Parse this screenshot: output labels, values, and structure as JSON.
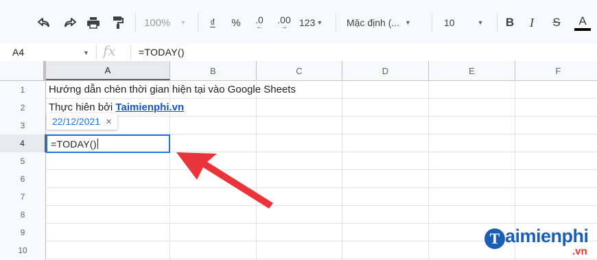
{
  "toolbar": {
    "undo_icon": "undo-icon",
    "redo_icon": "redo-icon",
    "print_icon": "print-icon",
    "paint_format_icon": "paint-format-icon",
    "zoom": "100%",
    "currency": "₫",
    "percent": "%",
    "decrease_decimal": ".0",
    "increase_decimal": ".00",
    "more_formats": "123",
    "font": "Mặc định (...",
    "font_size": "10",
    "bold": "B",
    "italic": "I",
    "strikethrough": "S",
    "text_color": "A"
  },
  "formula_bar": {
    "cell_ref": "A4",
    "fx": "fx",
    "formula": "=TODAY()"
  },
  "columns": [
    "A",
    "B",
    "C",
    "D",
    "E",
    "F"
  ],
  "rows": [
    "1",
    "2",
    "3",
    "4",
    "5",
    "6",
    "7",
    "8",
    "9",
    "10"
  ],
  "cells": {
    "A1": "Hướng dẫn chèn thời gian hiện tại vào Google Sheets",
    "A2_prefix": "Thực hiên bởi ",
    "A2_link": "Taimienphi.vn",
    "A4": "=TODAY()"
  },
  "hint": {
    "value": "22/12/2021",
    "close": "×"
  },
  "watermark": {
    "logo_letter": "T",
    "name": "aimienphi",
    "suffix": ".vn"
  },
  "colors": {
    "selection": "#1a73e8",
    "link": "#1155cc",
    "arrow": "#e8343a"
  }
}
